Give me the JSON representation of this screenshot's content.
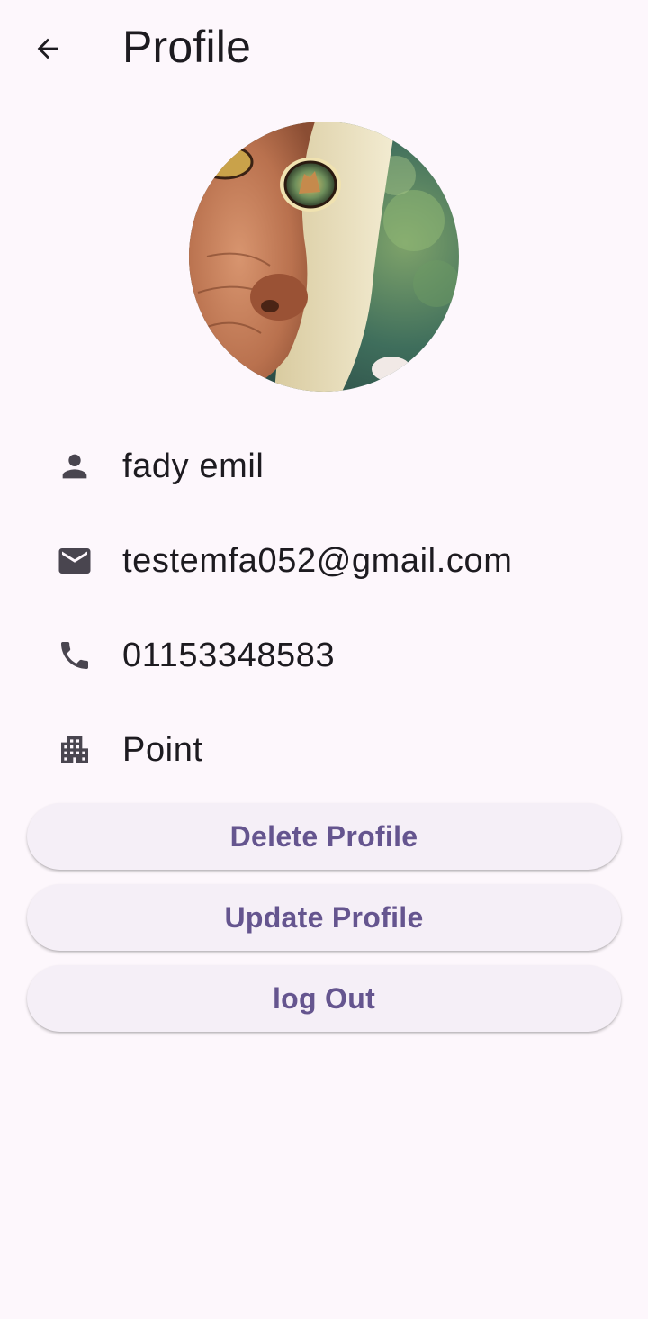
{
  "app_bar": {
    "back_icon": "arrow-back-icon",
    "title": "Profile"
  },
  "avatar": {
    "description_icon": "profile-photo"
  },
  "profile": {
    "rows": [
      {
        "icon": "person-icon",
        "value": "fady emil"
      },
      {
        "icon": "email-icon",
        "value": "testemfa052@gmail.com"
      },
      {
        "icon": "phone-icon",
        "value": "01153348583"
      },
      {
        "icon": "apartment-icon",
        "value": "Point"
      }
    ]
  },
  "actions": {
    "delete_label": "Delete Profile",
    "update_label": "Update Profile",
    "logout_label": "log Out"
  },
  "colors": {
    "background": "#fdf7fc",
    "button_background": "#f5eff7",
    "button_text": "#65558f",
    "icon": "#49454f",
    "text": "#1d1b20"
  }
}
